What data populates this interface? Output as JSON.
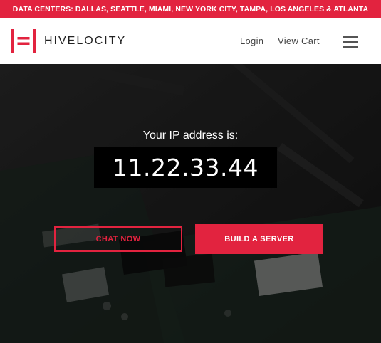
{
  "announcement": {
    "text": "DATA CENTERS: DALLAS, SEATTLE, MIAMI, NEW YORK CITY, TAMPA, LOS ANGELES & ATLANTA"
  },
  "header": {
    "brand": "HIVELOCITY",
    "nav": {
      "login": "Login",
      "view_cart": "View Cart"
    },
    "menu_icon": "hamburger-icon"
  },
  "hero": {
    "ip_label": "Your IP address is:",
    "ip_value": "11.22.33.44",
    "chat_button": "CHAT NOW",
    "build_button": "BUILD A SERVER"
  },
  "colors": {
    "brand_red": "#e2233f",
    "header_bg": "#ffffff",
    "hero_bg": "#1a1a1a"
  }
}
